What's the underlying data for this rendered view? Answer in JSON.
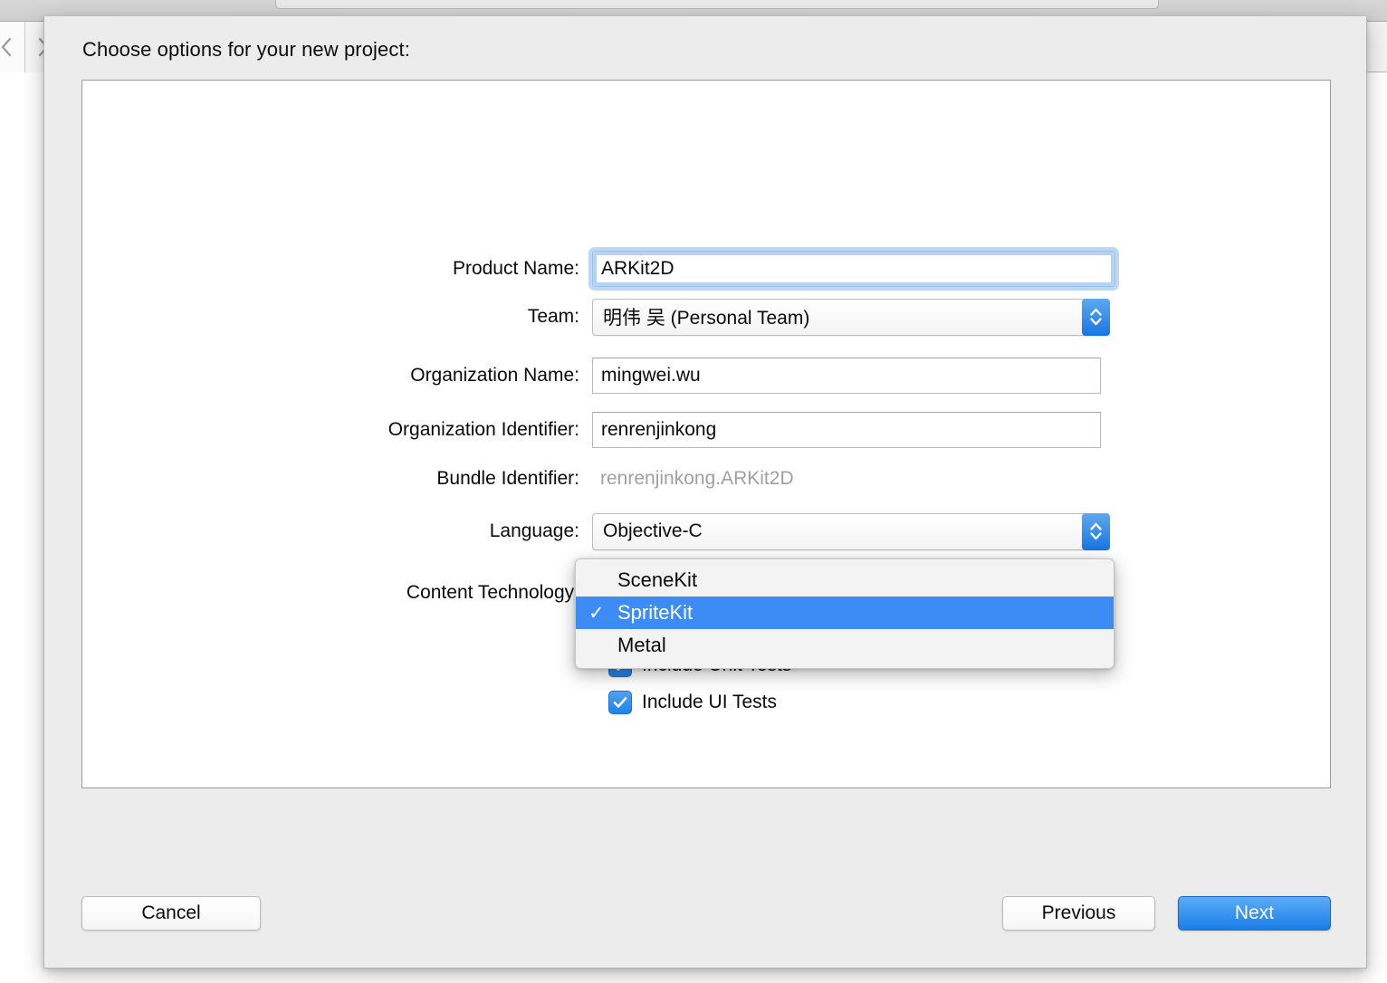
{
  "background": {
    "back_icon": "chevron-left-icon",
    "forward_icon": "chevron-right-icon"
  },
  "sheet": {
    "title": "Choose options for your new project:"
  },
  "form": {
    "fields": [
      {
        "key": "product_name",
        "label": "Product Name:",
        "value": "ARKit2D",
        "placeholder": "",
        "type": "text",
        "focused": true
      },
      {
        "key": "team",
        "label": "Team:",
        "value": "明伟 吴 (Personal Team)",
        "type": "popup"
      },
      {
        "key": "organization_name",
        "label": "Organization Name:",
        "value": "mingwei.wu",
        "placeholder": "",
        "type": "text",
        "focused": false
      },
      {
        "key": "organization_identifier",
        "label": "Organization Identifier:",
        "value": "renrenjinkong",
        "placeholder": "",
        "type": "text",
        "focused": false
      },
      {
        "key": "bundle_identifier",
        "label": "Bundle Identifier:",
        "value": "renrenjinkong.ARKit2D",
        "type": "static"
      },
      {
        "key": "language",
        "label": "Language:",
        "value": "Objective-C",
        "type": "popup"
      },
      {
        "key": "content_technology",
        "label": "Content Technology:",
        "value": "SpriteKit",
        "type": "popup"
      }
    ],
    "checkboxes": [
      {
        "key": "include_unit_tests",
        "label": "Include Unit Tests",
        "checked": true
      },
      {
        "key": "include_ui_tests",
        "label": "Include UI Tests",
        "checked": true
      }
    ]
  },
  "language_menu": {
    "open": true,
    "items": [
      {
        "label": "SceneKit",
        "checked": false,
        "highlighted": false
      },
      {
        "label": "SpriteKit",
        "checked": true,
        "highlighted": true
      },
      {
        "label": "Metal",
        "checked": false,
        "highlighted": false
      }
    ],
    "check_glyph": "✓"
  },
  "footer": {
    "cancel_label": "Cancel",
    "previous_label": "Previous",
    "next_label": "Next"
  },
  "colors": {
    "accent_blue": "#1a7ee8",
    "menu_highlight": "#3d8cf5",
    "focus_ring": "#bcd8f4",
    "disabled_text": "#a0a0a0",
    "sheet_bg": "#ececec"
  }
}
